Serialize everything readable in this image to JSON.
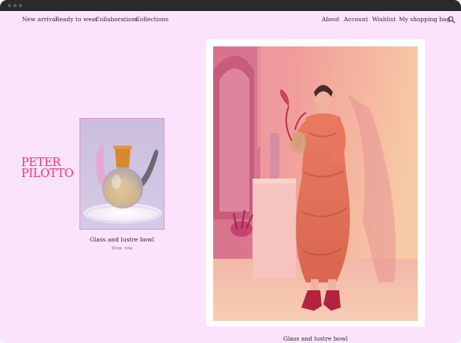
{
  "nav": {
    "left": [
      "New arrival",
      "Ready to wear",
      "Collaborations",
      "Collections"
    ],
    "right": [
      "About",
      "Account",
      "Wishlist",
      "My shopping bag"
    ],
    "search_icon": "search-icon"
  },
  "brand": {
    "logo_line1": "PETER",
    "logo_line2": "PILOTTO",
    "color": "#f0347a"
  },
  "product": {
    "title": "Glass and lustre bowl",
    "link": "Shop now"
  },
  "feature": {
    "caption": "Glass and lustre bowl"
  },
  "colors": {
    "background": "#fbe3fb",
    "titlebar": "#2a2a2c"
  }
}
